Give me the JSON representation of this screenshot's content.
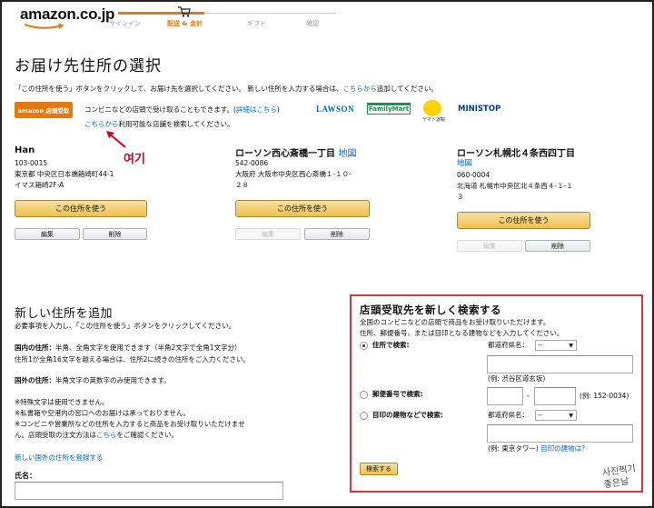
{
  "header": {
    "logo": "amazon.co.jp",
    "steps": [
      "サインイン",
      "配送 & 会計",
      "ギフト",
      "確認"
    ]
  },
  "page": {
    "title": "お届け先住所の選択",
    "instruction_prefix": "「この住所を使う」ボタンをクリックして、お届け先を選択してください。 新しい住所を入力する場合は、",
    "instruction_link": "こちらから",
    "instruction_suffix": "追加してください。"
  },
  "convenience": {
    "amazon_badge": "amazon 店頭受取",
    "text_prefix": "コンビニなどの店頭で受け取ることもできます。(",
    "detail_link": "詳細はこちら",
    "text_suffix": ")",
    "search_link": "こちらから",
    "search_suffix": "利用可能な店舗を検索してください。",
    "brands": [
      "LAWSON",
      "FamilyMart",
      "ヤマト運輸",
      "MINISTOP"
    ]
  },
  "annotation": {
    "label": "여기"
  },
  "addresses": [
    {
      "name": "Han",
      "map": "",
      "zip": "103-0015",
      "lines": [
        "東京都 中央区日本橋箱崎町44-1",
        "イマス箱崎2F-A"
      ],
      "use": "この住所を使う",
      "edit": "編集",
      "delete": "削除"
    },
    {
      "name": "ローソン西心斎橋一丁目",
      "map": "地図",
      "zip": "542-0086",
      "lines": [
        "大阪府 大阪市中央区西心斎橋１-１０-",
        "２８"
      ],
      "use": "この住所を使う",
      "edit": "編集",
      "delete": "削除"
    },
    {
      "name": "ローソン札幌北４条西四丁目",
      "map": "地図",
      "zip": "060-0004",
      "lines": [
        "北海道 札幌市中央区北４条西４-１-１",
        "３"
      ],
      "use": "この住所を使う",
      "edit": "編集",
      "delete": "削除"
    }
  ],
  "new_address": {
    "title": "新しい住所を追加",
    "intro": "必要事項を入力し、「この住所を使う」ボタンをクリックしてください。",
    "domestic_label": "国内の住所：",
    "domestic_1": "半角、全角文字を使用できます（半角2文字で全角1文字分）",
    "domestic_2": "住所1が全角16文字を越える場合は、住所2に続きの住所をご入力ください。",
    "foreign_label": "国外の住所：",
    "foreign_1": "半角文字の英数字のみ使用できます。",
    "note_1": "※特殊文字は使用できません。",
    "note_2": "※私書箱や空港内の窓口へのお届けは承っておりません。",
    "note_3": "※コンビニや営業所などの住所を入力すると商品をお受け取りいただけませ",
    "note_4_prefix": "ん。店頭受取の注文方法は",
    "note_4_link": "こちら",
    "note_4_suffix": "をご確認ください。",
    "foreign_link": "新しい国外の住所を登録する",
    "name_label": "氏名："
  },
  "pickup_search": {
    "title": "店頭受取先を新しく検索する",
    "desc_1": "全国のコンビニなどの店頭で商品をお受け取りいただけます。",
    "desc_2": "住所、郵便番号、または目印となる建物などを入力してください。",
    "opt_address": "住所で検索:",
    "opt_zip": "郵便番号で検索:",
    "opt_landmark": "目印の建物などで検索:",
    "pref_label": "都道府県名：",
    "pref_value": "--",
    "ex_address": "(例: 渋谷区道玄坂)",
    "zip_dash": "-",
    "ex_zip": "(例: 152-0034)",
    "ex_landmark_prefix": "(例: 東京タワー)",
    "ex_landmark_link": "目印の建物は？",
    "search_button": "検索する"
  },
  "watermark": {
    "line1": "사진찍기",
    "line2": "좋은날"
  },
  "colors": {
    "accent": "#e47911",
    "link": "#0066c0",
    "highlight": "#d9363e",
    "button": "#f0c14b"
  }
}
